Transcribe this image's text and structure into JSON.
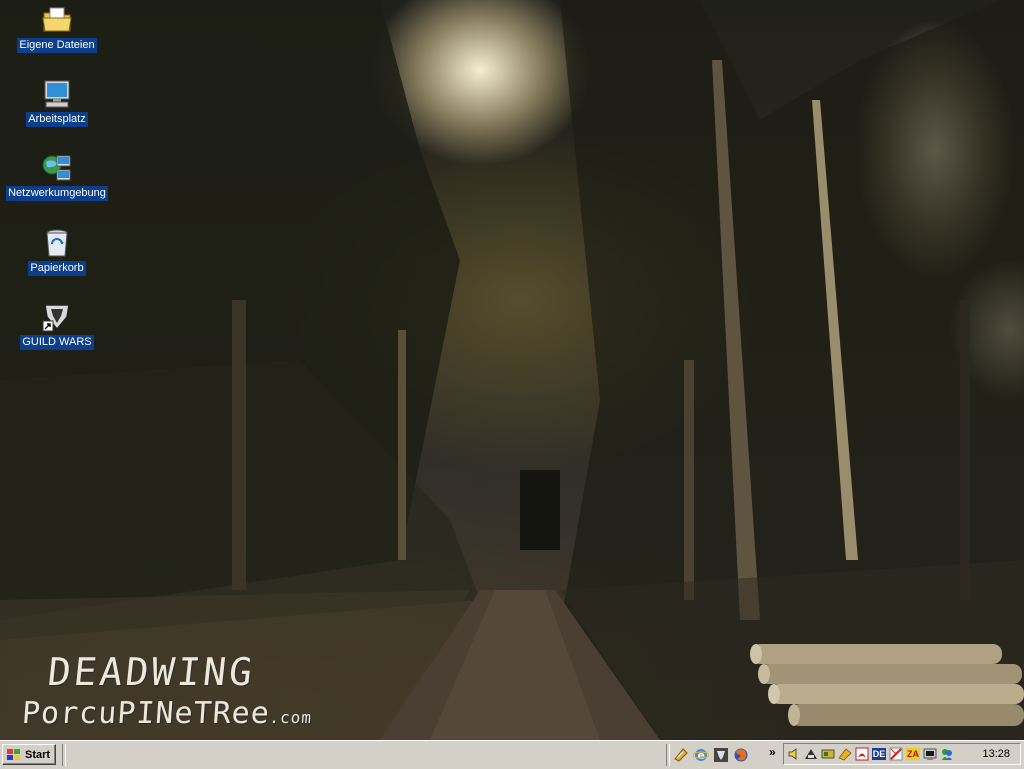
{
  "desktop": {
    "wallpaper_text": {
      "line1": "DEADWING",
      "line2": "PorcuPINeTRee",
      "domain": ".com"
    },
    "icons": [
      {
        "label": "Eigene Dateien",
        "icon": "my-documents-folder-icon"
      },
      {
        "label": "Arbeitsplatz",
        "icon": "my-computer-icon"
      },
      {
        "label": "Netzwerkumgebung",
        "icon": "network-places-icon"
      },
      {
        "label": "Papierkorb",
        "icon": "recycle-bin-icon"
      },
      {
        "label": "GUILD WARS",
        "icon": "guild-wars-shortcut-icon"
      }
    ],
    "label_highlight_color": "#0b3f8e"
  },
  "taskbar": {
    "start_label": "Start",
    "quick_launch": [
      {
        "icon": "launcher-icon"
      },
      {
        "icon": "internet-explorer-icon"
      },
      {
        "icon": "media-icon"
      },
      {
        "icon": "firefox-icon"
      }
    ],
    "chevron": "»",
    "tray": [
      {
        "icon": "volume-icon"
      },
      {
        "icon": "network-icon"
      },
      {
        "icon": "tray-app-icon"
      },
      {
        "icon": "tray-app-icon-2"
      },
      {
        "icon": "acrobat-icon"
      },
      {
        "icon": "language-indicator",
        "text": "DE"
      },
      {
        "icon": "security-icon"
      },
      {
        "icon": "zonealarm-icon",
        "text": "ZA"
      },
      {
        "icon": "tray-app-icon-3"
      },
      {
        "icon": "messenger-icon"
      }
    ],
    "clock": "13:28",
    "background_color": "#d4d0c8"
  }
}
